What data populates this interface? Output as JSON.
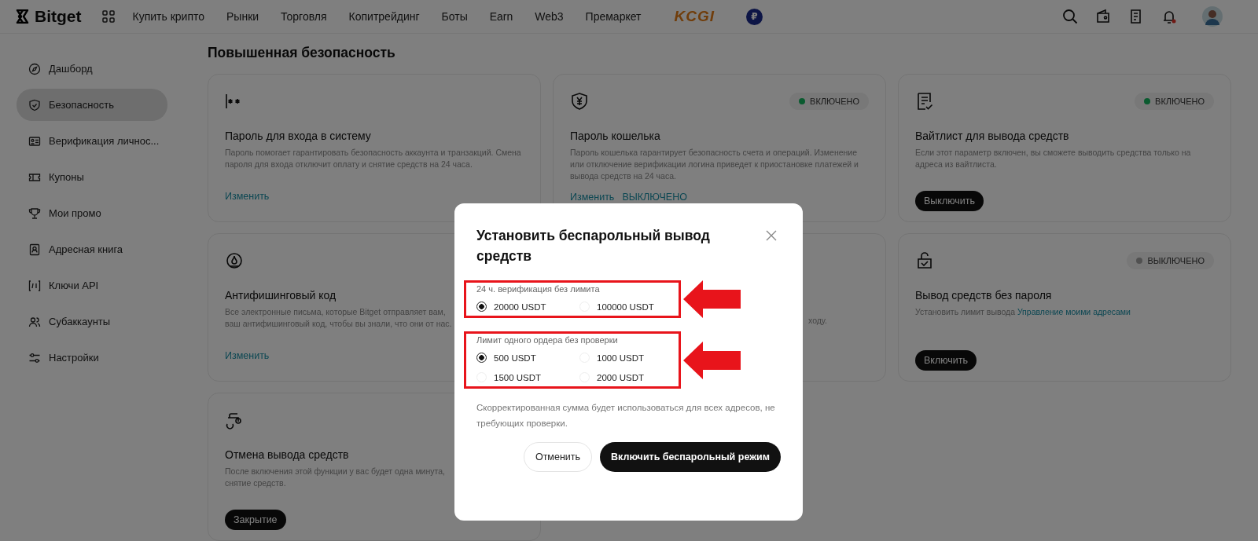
{
  "header": {
    "logo": "Bitget",
    "nav": [
      "Купить крипто",
      "Рынки",
      "Торговля",
      "Копитрейдинг",
      "Боты",
      "Earn",
      "Web3",
      "Премаркет"
    ],
    "promo_logo": "KCGI",
    "currency_badge": "₽"
  },
  "sidebar": {
    "items": [
      {
        "label": "Дашборд",
        "selected": false
      },
      {
        "label": "Безопасность",
        "selected": true
      },
      {
        "label": "Верификация личнос...",
        "selected": false
      },
      {
        "label": "Купоны",
        "selected": false
      },
      {
        "label": "Мои промо",
        "selected": false
      },
      {
        "label": "Адресная книга",
        "selected": false
      },
      {
        "label": "Ключи API",
        "selected": false
      },
      {
        "label": "Субаккаунты",
        "selected": false
      },
      {
        "label": "Настройки",
        "selected": false
      }
    ]
  },
  "section_title": "Повышенная безопасность",
  "cards": [
    {
      "title": "Пароль для входа в систему",
      "description_lines": [
        "Пароль помогает гарантировать безопасность аккаунта и транзакций. Смена",
        "пароля для входа отключит оплату и снятие средств на 24 часа."
      ],
      "actions": [
        {
          "kind": "link",
          "label": "Изменить"
        }
      ]
    },
    {
      "status": {
        "label": "ВКЛЮЧЕНО",
        "on": true
      },
      "title": "Пароль кошелька",
      "description_lines": [
        "Пароль кошелька гарантирует безопасность счета и операций. Изменение",
        "или отключение верификации логина приведет к приостановке платежей и",
        "вывода средств на 24 часа."
      ],
      "actions": [
        {
          "kind": "link",
          "label": "Изменить"
        },
        {
          "kind": "link",
          "label": "ВЫКЛЮЧЕНО"
        }
      ]
    },
    {
      "status": {
        "label": "ВКЛЮЧЕНО",
        "on": true
      },
      "title": "Вайтлист для вывода средств",
      "description_lines": [
        "Если этот параметр включен, вы сможете выводить средства только на",
        "адреса из вайтлиста."
      ],
      "actions": [
        {
          "kind": "button",
          "label": "Выключить"
        }
      ]
    },
    {
      "title": "Антифишинговый код",
      "description_lines": [
        "Все электронные письма, которые Bitget отправляет вам,",
        "ваш антифишинговый код, чтобы вы знали, что они от нас."
      ],
      "actions": [
        {
          "kind": "link",
          "label": "Изменить"
        }
      ]
    },
    {
      "kind": "covered",
      "tail": "ходу."
    },
    {
      "status": {
        "label": "ВЫКЛЮЧЕНО",
        "on": false
      },
      "title": "Вывод средств без пароля",
      "description": "Установить лимит вывода **Управление моими адресами**",
      "actions": [
        {
          "kind": "button",
          "label": "Включить"
        }
      ]
    },
    {
      "title": "Отмена вывода средств",
      "description_lines": [
        "После включения этой функции у вас будет одна минута,",
        "снятие средств."
      ],
      "actions": [
        {
          "kind": "button",
          "label": "Закрытие"
        }
      ]
    }
  ],
  "dialog": {
    "title": "Установить беспарольный вывод средств",
    "groups": [
      {
        "label": "24 ч. верификация без лимита",
        "options": [
          {
            "label": "20000 USDT",
            "selected": true
          },
          {
            "label": "100000 USDT",
            "selected": false
          }
        ]
      },
      {
        "label": "Лимит одного ордера без проверки",
        "options": [
          {
            "label": "500 USDT",
            "selected": true
          },
          {
            "label": "1000 USDT",
            "selected": false
          },
          {
            "label": "1500 USDT",
            "selected": false
          },
          {
            "label": "2000 USDT",
            "selected": false
          }
        ]
      }
    ],
    "note": "Скорректированная сумма будет использоваться для всех адресов, не требующих проверки.",
    "buttons": [
      {
        "kind": "secondary",
        "label": "Отменить"
      },
      {
        "kind": "primary",
        "label": "Включить беспарольный режим"
      }
    ]
  }
}
